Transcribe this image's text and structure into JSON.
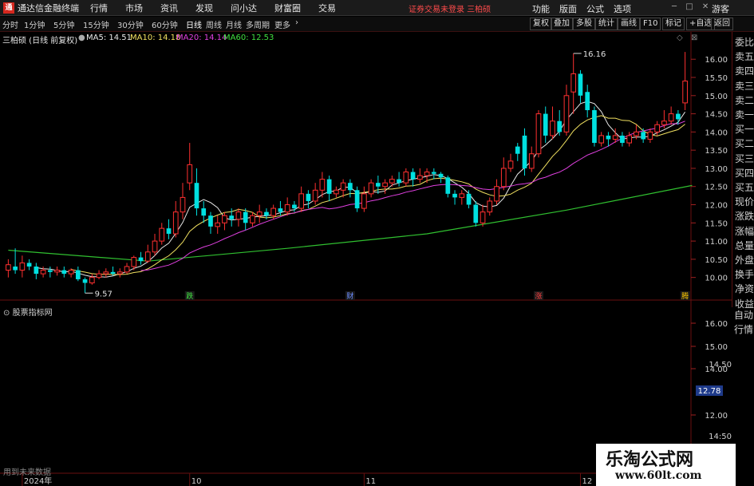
{
  "window": {
    "title": "通达信金融终端",
    "menus": [
      "行情",
      "市场",
      "资讯",
      "发现",
      "问小达",
      "财富圈",
      "交易"
    ],
    "status": "证券交易未登录  三柏硕",
    "right_menus": [
      "功能",
      "版面",
      "公式",
      "选项"
    ],
    "login": "游客"
  },
  "toolbar": {
    "periods": [
      "分时",
      "1分钟",
      "5分钟",
      "15分钟",
      "30分钟",
      "60分钟",
      "日线",
      "周线",
      "月线",
      "多周期",
      "更多"
    ],
    "active_period": "日线",
    "right_buttons": [
      "复权",
      "叠加",
      "多股",
      "统计",
      "画线",
      "F10",
      "标记",
      "+自选",
      "返回"
    ]
  },
  "stock": {
    "name_line": "三柏硕 (日线 前复权)",
    "ma": [
      {
        "label": "MA5: 14.51",
        "color": "#e8e8e8"
      },
      {
        "label": "MA10: 14.18",
        "color": "#f0e060"
      },
      {
        "label": "MA20: 14.14",
        "color": "#e040e0"
      },
      {
        "label": "MA60: 12.53",
        "color": "#40e040"
      }
    ]
  },
  "sidebar": {
    "upper": [
      "委比",
      "卖五",
      "卖四",
      "卖三",
      "卖二",
      "卖一",
      "买一",
      "买二",
      "买三",
      "买四",
      "买五",
      "现价",
      "涨跌",
      "涨幅",
      "总量",
      "外盘",
      "换手",
      "净资",
      "收益"
    ],
    "lower": [
      "自动",
      "行情"
    ]
  },
  "lower_panel": {
    "title": "股票指标网",
    "future_text": "用到未来数据",
    "price_tag": "12.78",
    "axis_labels": [
      "16.00",
      "15.00",
      "14.50",
      "14:50",
      "14.00",
      "12.78",
      "12.00",
      "14:50"
    ]
  },
  "chart_data": {
    "type": "candlestick",
    "ylim": [
      9.4,
      16.4
    ],
    "y_ticks": [
      10.0,
      10.5,
      11.0,
      11.5,
      12.0,
      12.5,
      13.0,
      13.5,
      14.0,
      14.5,
      15.0,
      15.5,
      16.0
    ],
    "y_tick_labels": [
      "10.00",
      "10.50",
      "11.00",
      "11.50",
      "12.00",
      "12.50",
      "13.00",
      "13.50",
      "14.00",
      "14.50",
      "15.00",
      "15.50",
      "16.00"
    ],
    "annotations": [
      {
        "label": "9.57",
        "index": 11,
        "value": 9.57
      },
      {
        "label": "16.16",
        "index": 81,
        "value": 16.16
      }
    ],
    "event_markers": [
      {
        "label": "跌",
        "index": 26,
        "color": "#40e040"
      },
      {
        "label": "财",
        "index": 49,
        "color": "#6a8cff"
      },
      {
        "label": "涨",
        "index": 76,
        "color": "#ff4040"
      },
      {
        "label": "腾",
        "index": 97,
        "color": "#ffcc00"
      }
    ],
    "x_labels": [
      {
        "label": "2024年",
        "index": 2
      },
      {
        "label": "10",
        "index": 26
      },
      {
        "label": "11",
        "index": 51
      },
      {
        "label": "12",
        "index": 82
      }
    ],
    "candles": [
      [
        10.2,
        10.35,
        10.5,
        10.0
      ],
      [
        10.3,
        10.2,
        10.8,
        10.1
      ],
      [
        10.2,
        10.4,
        10.6,
        10.0
      ],
      [
        10.4,
        10.3,
        10.5,
        10.2
      ],
      [
        10.3,
        10.1,
        10.4,
        9.95
      ],
      [
        10.1,
        10.2,
        10.3,
        10.0
      ],
      [
        10.2,
        10.15,
        10.3,
        10.0
      ],
      [
        10.15,
        10.2,
        10.3,
        10.05
      ],
      [
        10.2,
        10.1,
        10.3,
        10.0
      ],
      [
        10.1,
        10.2,
        10.25,
        10.0
      ],
      [
        10.2,
        9.95,
        10.3,
        9.9
      ],
      [
        9.95,
        9.85,
        10.0,
        9.57
      ],
      [
        9.85,
        10.0,
        10.1,
        9.8
      ],
      [
        10.0,
        10.1,
        10.2,
        9.95
      ],
      [
        10.1,
        10.15,
        10.25,
        10.0
      ],
      [
        10.15,
        10.1,
        10.3,
        10.05
      ],
      [
        10.1,
        10.15,
        10.25,
        10.0
      ],
      [
        10.15,
        10.3,
        10.4,
        10.1
      ],
      [
        10.3,
        10.55,
        10.6,
        10.2
      ],
      [
        10.55,
        10.45,
        10.7,
        10.35
      ],
      [
        10.45,
        10.7,
        10.9,
        10.4
      ],
      [
        10.7,
        11.0,
        11.2,
        10.6
      ],
      [
        11.0,
        11.35,
        11.5,
        10.9
      ],
      [
        11.35,
        11.2,
        11.6,
        11.05
      ],
      [
        11.2,
        11.8,
        12.1,
        11.1
      ],
      [
        11.8,
        12.2,
        12.6,
        11.6
      ],
      [
        12.6,
        13.1,
        13.7,
        12.4
      ],
      [
        12.6,
        11.9,
        13.0,
        11.7
      ],
      [
        11.9,
        11.7,
        12.1,
        11.5
      ],
      [
        11.7,
        11.4,
        11.8,
        11.2
      ],
      [
        11.4,
        11.5,
        11.7,
        11.2
      ],
      [
        11.5,
        11.7,
        11.8,
        11.3
      ],
      [
        11.7,
        11.6,
        11.9,
        11.4
      ],
      [
        11.6,
        11.8,
        11.9,
        11.4
      ],
      [
        11.8,
        11.5,
        11.9,
        11.3
      ],
      [
        11.5,
        11.7,
        11.8,
        11.4
      ],
      [
        11.7,
        11.8,
        12.0,
        11.5
      ],
      [
        11.8,
        11.7,
        11.9,
        11.6
      ],
      [
        11.7,
        11.9,
        12.0,
        11.6
      ],
      [
        11.9,
        11.8,
        12.1,
        11.7
      ],
      [
        11.8,
        12.0,
        12.2,
        11.7
      ],
      [
        12.0,
        11.9,
        12.1,
        11.8
      ],
      [
        11.9,
        12.3,
        12.5,
        11.8
      ],
      [
        12.3,
        12.1,
        12.4,
        11.9
      ],
      [
        12.1,
        12.4,
        12.6,
        12.0
      ],
      [
        12.4,
        12.7,
        12.9,
        12.2
      ],
      [
        12.7,
        12.3,
        12.8,
        12.1
      ],
      [
        12.3,
        12.4,
        12.5,
        12.2
      ],
      [
        12.4,
        12.6,
        12.7,
        12.2
      ],
      [
        12.6,
        12.4,
        12.7,
        12.2
      ],
      [
        12.4,
        11.9,
        12.5,
        11.8
      ],
      [
        11.9,
        12.3,
        12.5,
        11.8
      ],
      [
        12.3,
        12.6,
        12.7,
        12.2
      ],
      [
        12.6,
        12.5,
        12.8,
        12.3
      ],
      [
        12.5,
        12.6,
        12.7,
        12.3
      ],
      [
        12.6,
        12.7,
        12.8,
        12.5
      ],
      [
        12.7,
        12.6,
        12.9,
        12.5
      ],
      [
        12.6,
        12.9,
        13.0,
        12.5
      ],
      [
        12.9,
        12.7,
        13.0,
        12.5
      ],
      [
        12.7,
        12.8,
        13.0,
        12.6
      ],
      [
        12.8,
        12.9,
        13.0,
        12.6
      ],
      [
        12.9,
        12.85,
        13.0,
        12.7
      ],
      [
        12.85,
        12.75,
        12.9,
        12.6
      ],
      [
        12.75,
        12.3,
        12.8,
        12.2
      ],
      [
        12.3,
        12.2,
        12.4,
        12.0
      ],
      [
        12.2,
        12.3,
        12.4,
        12.0
      ],
      [
        12.3,
        12.0,
        12.4,
        11.9
      ],
      [
        12.0,
        11.5,
        12.1,
        11.4
      ],
      [
        11.5,
        11.8,
        12.0,
        11.4
      ],
      [
        11.8,
        12.1,
        12.2,
        11.7
      ],
      [
        12.1,
        12.5,
        12.7,
        12.0
      ],
      [
        12.5,
        13.0,
        13.3,
        12.4
      ],
      [
        13.0,
        13.2,
        13.4,
        12.9
      ],
      [
        13.6,
        13.4,
        13.7,
        13.2
      ],
      [
        13.9,
        13.0,
        14.1,
        12.8
      ],
      [
        13.0,
        13.4,
        13.6,
        12.9
      ],
      [
        13.4,
        14.5,
        14.6,
        13.3
      ],
      [
        14.5,
        13.9,
        14.7,
        13.7
      ],
      [
        13.9,
        14.3,
        14.7,
        13.8
      ],
      [
        14.3,
        14.0,
        14.6,
        13.9
      ],
      [
        14.0,
        15.0,
        15.3,
        13.9
      ],
      [
        15.1,
        15.6,
        16.16,
        14.5
      ],
      [
        15.6,
        15.0,
        15.7,
        14.8
      ],
      [
        15.1,
        14.6,
        15.3,
        14.4
      ],
      [
        14.6,
        13.7,
        14.7,
        13.6
      ],
      [
        13.7,
        13.9,
        14.0,
        13.6
      ],
      [
        13.9,
        13.8,
        14.0,
        13.6
      ],
      [
        13.8,
        13.9,
        14.1,
        13.7
      ],
      [
        13.9,
        13.7,
        14.0,
        13.6
      ],
      [
        13.7,
        13.9,
        14.0,
        13.6
      ],
      [
        13.9,
        14.0,
        14.2,
        13.8
      ],
      [
        14.0,
        13.8,
        14.1,
        13.7
      ],
      [
        13.8,
        14.0,
        14.1,
        13.7
      ],
      [
        14.0,
        14.2,
        14.3,
        13.9
      ],
      [
        14.2,
        14.3,
        14.6,
        14.1
      ],
      [
        14.3,
        14.5,
        14.7,
        14.2
      ],
      [
        14.5,
        14.35,
        14.6,
        14.2
      ],
      [
        14.8,
        15.4,
        16.2,
        14.6
      ]
    ],
    "ma60": [
      [
        0,
        10.75
      ],
      [
        20,
        10.45
      ],
      [
        40,
        10.8
      ],
      [
        60,
        11.2
      ],
      [
        80,
        11.85
      ],
      [
        98,
        12.53
      ]
    ],
    "lower_panel_yticks": [
      "16.00",
      "15.00",
      "14.50",
      "14.00",
      "12.78",
      "12.00"
    ]
  }
}
